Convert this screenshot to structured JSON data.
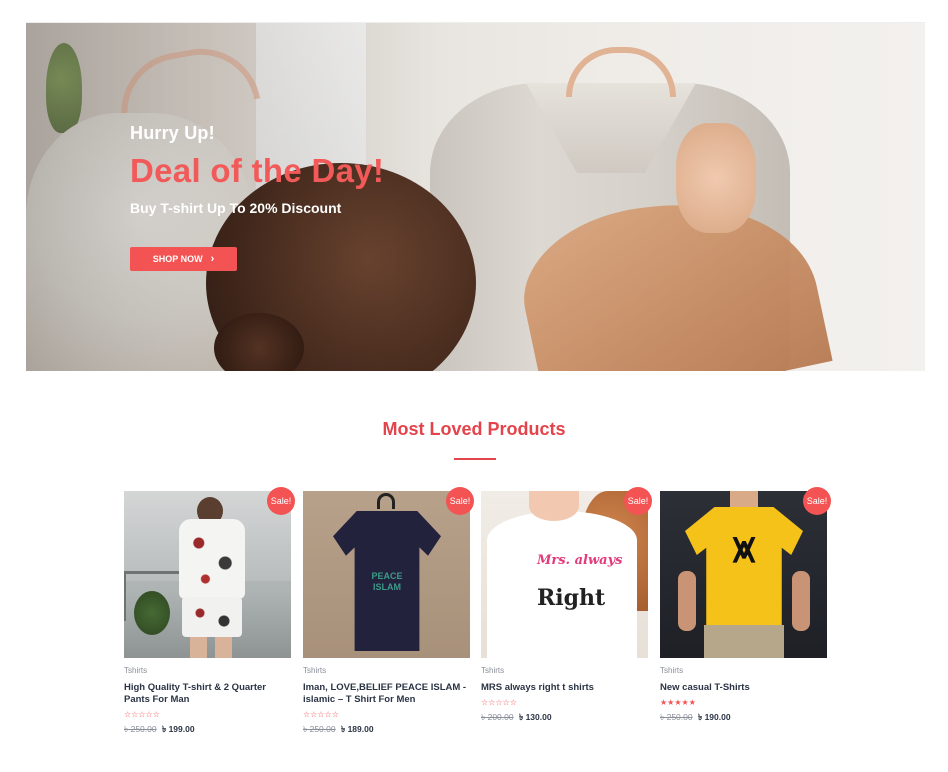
{
  "hero": {
    "kicker": "Hurry Up!",
    "title": "Deal of the Day!",
    "subtitle": "Buy T-shirt Up To 20% Discount",
    "button_label": "SHOP NOW",
    "button_icon": "chevron-right-icon",
    "accent_color": "#f35353"
  },
  "section": {
    "title": "Most Loved Products",
    "title_color": "#e3444b"
  },
  "products": [
    {
      "badge": "Sale!",
      "category": "Tshirts",
      "name": "High Quality T-shirt & 2 Quarter Pants For Man",
      "rating": 0,
      "stars": "☆☆☆☆☆",
      "old_price": "৳ 250.00",
      "new_price": "৳ 199.00"
    },
    {
      "badge": "Sale!",
      "category": "Tshirts",
      "name": "Iman, LOVE,BELIEF PEACE ISLAM - islamic – T Shirt For Men",
      "rating": 0,
      "stars": "☆☆☆☆☆",
      "old_price": "৳ 250.00",
      "new_price": "৳ 189.00"
    },
    {
      "badge": "Sale!",
      "category": "Tshirts",
      "name": "MRS always right t shirts",
      "rating": 0,
      "stars": "☆☆☆☆☆",
      "old_price": "৳ 200.00",
      "new_price": "৳ 130.00"
    },
    {
      "badge": "Sale!",
      "category": "Tshirts",
      "name": "New casual T-Shirts",
      "rating": 5,
      "stars": "★★★★★",
      "old_price": "৳ 250.00",
      "new_price": "৳ 190.00"
    }
  ],
  "print_art": {
    "p2_line1": "PEACE",
    "p2_line2": "ISLAM",
    "p3_line1": "Mrs.",
    "p3_line2": "always",
    "p3_line3": "Right"
  }
}
